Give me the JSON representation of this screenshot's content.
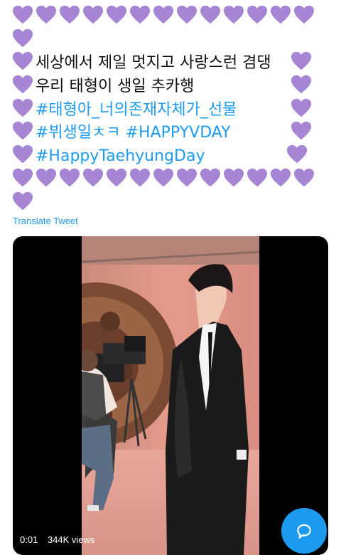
{
  "tweet": {
    "lines": [
      "세상에서 제일 멋지고 사랑스런 겸댕",
      "우리 태형이 생일 추카행"
    ],
    "hashtags": [
      "#태형아_너의존재자체가_선물",
      "#뷔생일ㅊㅋ #HAPPYVDAY",
      "#HappyTaehyungDay"
    ],
    "heart_icon": "purple-heart",
    "heart_color": "#a686d4"
  },
  "translate_label": "Translate Tweet",
  "video": {
    "time": "0:01",
    "views": "344K views"
  },
  "colors": {
    "link": "#1d9bf0",
    "fab": "#1d9bf0"
  }
}
